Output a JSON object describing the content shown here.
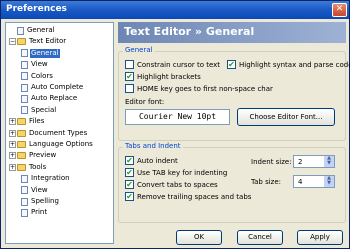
{
  "window": {
    "title": "Preferences",
    "close": "✕"
  },
  "tree": {
    "items": [
      {
        "label": "General",
        "type": "doc",
        "expander": ""
      },
      {
        "label": "Text Editor",
        "type": "folder",
        "expander": "−"
      },
      {
        "label": "General",
        "type": "doc",
        "selected": true
      },
      {
        "label": "View",
        "type": "doc"
      },
      {
        "label": "Colors",
        "type": "doc"
      },
      {
        "label": "Auto Complete",
        "type": "doc"
      },
      {
        "label": "Auto Replace",
        "type": "doc"
      },
      {
        "label": "Special",
        "type": "doc"
      },
      {
        "label": "Files",
        "type": "folder",
        "expander": "+"
      },
      {
        "label": "Document Types",
        "type": "folder",
        "expander": "+"
      },
      {
        "label": "Language Options",
        "type": "folder",
        "expander": "+"
      },
      {
        "label": "Preview",
        "type": "folder",
        "expander": "+"
      },
      {
        "label": "Tools",
        "type": "folder",
        "expander": "+"
      },
      {
        "label": "Integration",
        "type": "doc"
      },
      {
        "label": "View",
        "type": "doc"
      },
      {
        "label": "Spelling",
        "type": "doc"
      },
      {
        "label": "Print",
        "type": "doc"
      }
    ]
  },
  "header": {
    "title": "Text Editor » General"
  },
  "general": {
    "title": "General",
    "constrain_cursor": {
      "label": "Constrain cursor to text",
      "checked": false
    },
    "highlight_syntax": {
      "label": "Highlight syntax and parse code",
      "checked": true
    },
    "highlight_brackets": {
      "label": "Highlight brackets",
      "checked": true
    },
    "home_key": {
      "label": "HOME key goes to first non-space char",
      "checked": false
    },
    "editor_font_label": "Editor font:",
    "editor_font_value": "Courier New 10pt",
    "choose_font_button": "Choose Editor Font..."
  },
  "tabs": {
    "title": "Tabs and Indent",
    "auto_indent": {
      "label": "Auto indent",
      "checked": true
    },
    "use_tab_key": {
      "label": "Use TAB key for indenting",
      "checked": true
    },
    "convert_tabs": {
      "label": "Convert tabs to spaces",
      "checked": true
    },
    "remove_trailing": {
      "label": "Remove trailing spaces and tabs",
      "checked": true
    },
    "indent_size_label": "Indent size:",
    "indent_size_value": "2",
    "tab_size_label": "Tab size:",
    "tab_size_value": "4"
  },
  "footer": {
    "ok": "OK",
    "cancel": "Cancel",
    "apply": "Apply"
  },
  "spin_arrows": {
    "up": "▲",
    "down": "▼"
  },
  "check_mark": "✔"
}
